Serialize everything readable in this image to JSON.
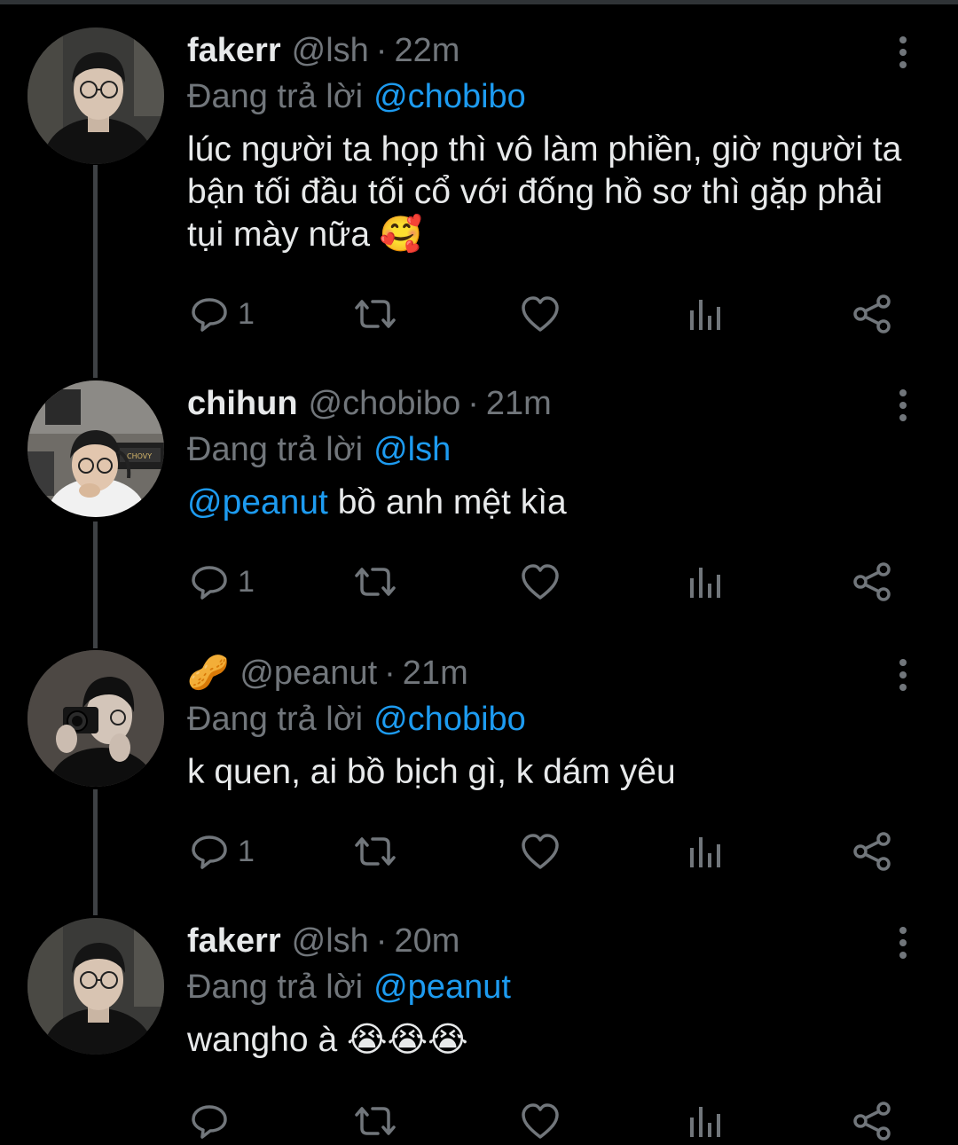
{
  "tweets": [
    {
      "display_name": "fakerr",
      "handle": "@lsh",
      "separator": "·",
      "time": "22m",
      "replying_prefix": "Đang trả lời",
      "replying_to": "@chobibo",
      "text": "lúc người ta họp thì vô làm phiền, giờ người ta bận tối đầu tối cổ với đống hồ sơ thì gặp phải tụi mày nữa 🥰",
      "reply_count": "1"
    },
    {
      "display_name": "chihun",
      "handle": "@chobibo",
      "separator": "·",
      "time": "21m",
      "replying_prefix": "Đang trả lời",
      "replying_to": "@lsh",
      "mention_in_text": "@peanut",
      "text": " bồ anh mệt kìa",
      "reply_count": "1"
    },
    {
      "display_name": "🥜",
      "handle": "@peanut",
      "separator": "·",
      "time": "21m",
      "replying_prefix": "Đang trả lời",
      "replying_to": "@chobibo",
      "text": "k quen, ai bồ bịch gì, k dám yêu",
      "reply_count": "1"
    },
    {
      "display_name": "fakerr",
      "handle": "@lsh",
      "separator": "·",
      "time": "20m",
      "replying_prefix": "Đang trả lời",
      "replying_to": "@peanut",
      "text": "wangho à 😭😭😭",
      "reply_count": ""
    }
  ],
  "icons": {
    "reply": "reply-bubble-icon",
    "retweet": "retweet-icon",
    "like": "heart-icon",
    "views": "analytics-icon",
    "share": "share-icon",
    "more": "more-vertical-icon"
  },
  "colors": {
    "background": "#000000",
    "text": "#e7e9ea",
    "muted": "#71767b",
    "link": "#1d9bf0",
    "thread_line": "#3e4144"
  }
}
